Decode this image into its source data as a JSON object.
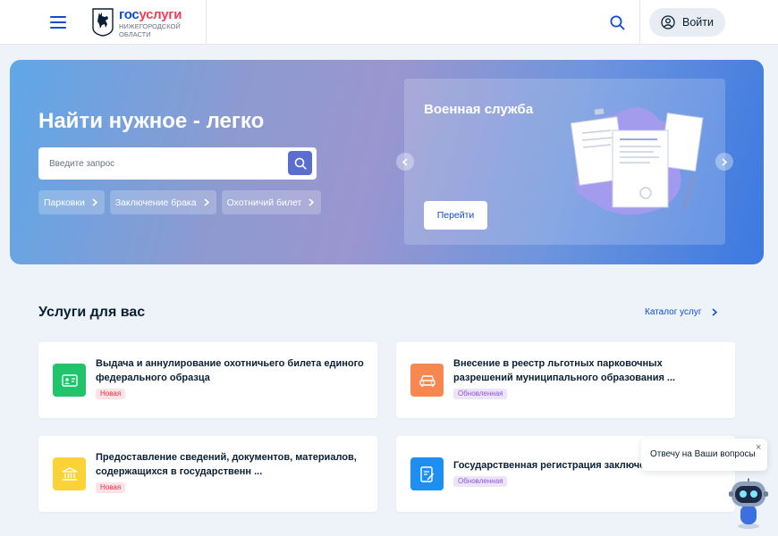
{
  "header": {
    "logo_main_a": "гос",
    "logo_main_b": "услуги",
    "logo_sub_1": "НИЖЕГОРОДСКОЙ",
    "logo_sub_2": "ОБЛАСТИ",
    "login_label": "Войти",
    "icons": [
      "menu-icon",
      "emblem-icon",
      "search-icon",
      "user-icon"
    ]
  },
  "hero": {
    "title": "Найти нужное - легко",
    "search_placeholder": "Введите запрос",
    "chips": [
      "Парковки",
      "Заключение брака",
      "Охотничий билет"
    ],
    "promo_title": "Военная служба",
    "promo_button": "Перейти"
  },
  "services": {
    "title": "Услуги для вас",
    "catalog_link": "Каталог услуг",
    "cards": [
      {
        "title": "Выдача и аннулирование охотничьего билета единого федерального образца",
        "badge": "Новая",
        "icon": "id-card-icon",
        "color": "#1fc46b"
      },
      {
        "title": "Внесение в реестр льготных парковочных разрешений муниципального образования ...",
        "badge": "Обновленная",
        "icon": "car-icon",
        "color": "#f7874f"
      },
      {
        "title": "Предоставление сведений, документов, материалов, содержащихся в государственн ...",
        "badge": "Новая",
        "icon": "bank-icon",
        "color": "#fbd337"
      },
      {
        "title": "Государственная регистрация заключения брака",
        "badge": "Обновленная",
        "icon": "document-edit-icon",
        "color": "#1e8ff2"
      }
    ]
  },
  "chat": {
    "bubble_text": "Отвечу на Ваши вопросы",
    "close": "×"
  },
  "colors": {
    "accent": "#0d4cd3",
    "brand_red": "#ee3f58",
    "page_bg": "#eef3fa"
  }
}
